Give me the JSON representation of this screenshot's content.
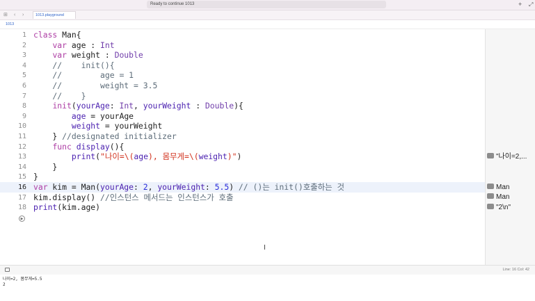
{
  "window": {
    "status_text": "Ready to continue 1013",
    "add_label": "+",
    "expand_label": "⤢"
  },
  "tab": {
    "title": "1013.playground",
    "nav_sidebar_icon": "sidebar-icon",
    "back_icon": "chevron-left-icon",
    "forward_icon": "chevron-right-icon"
  },
  "breadcrumb": {
    "label": "1013"
  },
  "editor": {
    "current_line": 16,
    "lines": [
      {
        "n": "1",
        "tokens": [
          {
            "t": "class",
            "c": "kw"
          },
          {
            "t": " Man{",
            "c": ""
          }
        ]
      },
      {
        "n": "2",
        "tokens": [
          {
            "t": "    ",
            "c": ""
          },
          {
            "t": "var",
            "c": "kw"
          },
          {
            "t": " age : ",
            "c": ""
          },
          {
            "t": "Int",
            "c": "ty"
          }
        ]
      },
      {
        "n": "3",
        "tokens": [
          {
            "t": "    ",
            "c": ""
          },
          {
            "t": "var",
            "c": "kw"
          },
          {
            "t": " weight : ",
            "c": ""
          },
          {
            "t": "Double",
            "c": "ty"
          }
        ]
      },
      {
        "n": "4",
        "tokens": [
          {
            "t": "    //    init(){",
            "c": "cm"
          }
        ]
      },
      {
        "n": "5",
        "tokens": [
          {
            "t": "    //        age = 1",
            "c": "cm"
          }
        ]
      },
      {
        "n": "6",
        "tokens": [
          {
            "t": "    //        weight = 3.5",
            "c": "cm"
          }
        ]
      },
      {
        "n": "7",
        "tokens": [
          {
            "t": "    //    }",
            "c": "cm"
          }
        ]
      },
      {
        "n": "8",
        "tokens": [
          {
            "t": "    ",
            "c": ""
          },
          {
            "t": "init",
            "c": "kw"
          },
          {
            "t": "(",
            "c": ""
          },
          {
            "t": "yourAge",
            "c": "id"
          },
          {
            "t": ": ",
            "c": ""
          },
          {
            "t": "Int",
            "c": "ty"
          },
          {
            "t": ", ",
            "c": ""
          },
          {
            "t": "yourWeight",
            "c": "id"
          },
          {
            "t": " : ",
            "c": ""
          },
          {
            "t": "Double",
            "c": "ty"
          },
          {
            "t": "){",
            "c": ""
          }
        ]
      },
      {
        "n": "9",
        "tokens": [
          {
            "t": "        ",
            "c": ""
          },
          {
            "t": "age",
            "c": "id"
          },
          {
            "t": " = yourAge",
            "c": ""
          }
        ]
      },
      {
        "n": "10",
        "tokens": [
          {
            "t": "        ",
            "c": ""
          },
          {
            "t": "weight",
            "c": "id"
          },
          {
            "t": " = yourWeight",
            "c": ""
          }
        ]
      },
      {
        "n": "11",
        "tokens": [
          {
            "t": "    } ",
            "c": ""
          },
          {
            "t": "//designated initializer",
            "c": "cm"
          }
        ]
      },
      {
        "n": "12",
        "tokens": [
          {
            "t": "    ",
            "c": ""
          },
          {
            "t": "func",
            "c": "kw"
          },
          {
            "t": " ",
            "c": ""
          },
          {
            "t": "display",
            "c": "id"
          },
          {
            "t": "(){",
            "c": ""
          }
        ]
      },
      {
        "n": "13",
        "tokens": [
          {
            "t": "        ",
            "c": ""
          },
          {
            "t": "print",
            "c": "id"
          },
          {
            "t": "(",
            "c": ""
          },
          {
            "t": "\"나이=\\(",
            "c": "str"
          },
          {
            "t": "age",
            "c": "id"
          },
          {
            "t": "), 몸무게=\\(",
            "c": "str"
          },
          {
            "t": "weight",
            "c": "id"
          },
          {
            "t": ")\"",
            "c": "str"
          },
          {
            "t": ")",
            "c": ""
          }
        ]
      },
      {
        "n": "14",
        "tokens": [
          {
            "t": "    }",
            "c": ""
          }
        ]
      },
      {
        "n": "15",
        "tokens": [
          {
            "t": "}",
            "c": ""
          }
        ]
      },
      {
        "n": "16",
        "tokens": [
          {
            "t": "var",
            "c": "kw"
          },
          {
            "t": " kim = Man(",
            "c": ""
          },
          {
            "t": "yourAge",
            "c": "id"
          },
          {
            "t": ": ",
            "c": ""
          },
          {
            "t": "2",
            "c": "num"
          },
          {
            "t": ", ",
            "c": ""
          },
          {
            "t": "yourWeight",
            "c": "id"
          },
          {
            "t": ": ",
            "c": ""
          },
          {
            "t": "5.5",
            "c": "num"
          },
          {
            "t": ") ",
            "c": ""
          },
          {
            "t": "// ()는 init()호출하는 것",
            "c": "cm"
          }
        ]
      },
      {
        "n": "17",
        "tokens": [
          {
            "t": "kim.display() ",
            "c": ""
          },
          {
            "t": "//인스턴스 메서드는 인스턴스가 호출",
            "c": "cm"
          }
        ]
      },
      {
        "n": "18",
        "tokens": [
          {
            "t": "print",
            "c": "id"
          },
          {
            "t": "(kim.age)",
            "c": ""
          }
        ]
      }
    ],
    "run_label": "▶"
  },
  "results": [
    {
      "line": 13,
      "text": "\"나이=2,..."
    },
    {
      "line": 16,
      "text": "Man"
    },
    {
      "line": 17,
      "text": "Man"
    },
    {
      "line": 18,
      "text": "\"2\\n\""
    }
  ],
  "bottombar": {
    "position_text": "Line: 16  Col: 42"
  },
  "console": {
    "lines": [
      "나이=2, 몸무게=5.5",
      "2"
    ]
  }
}
